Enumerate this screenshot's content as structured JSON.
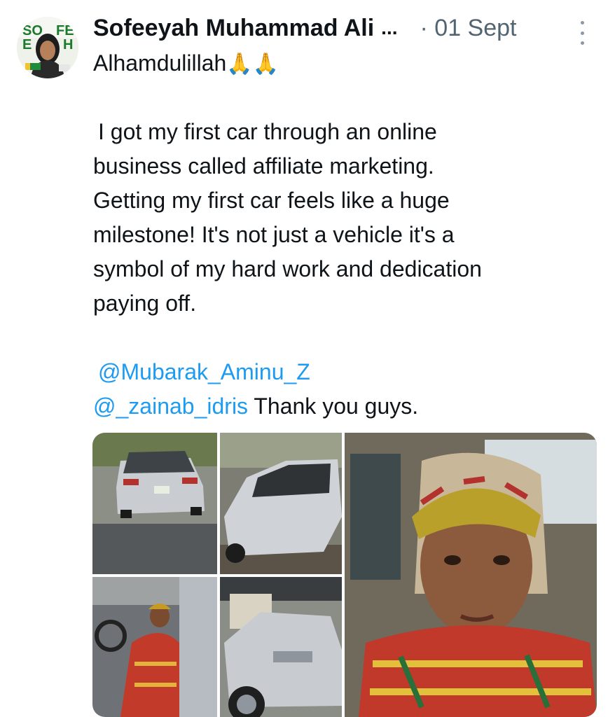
{
  "tweet": {
    "author": {
      "display_name": "Sofeeyah Muhammad Ali",
      "truncation": "...",
      "avatar_label": "profile-photo"
    },
    "separator": "·",
    "date": "01 Sept",
    "text_lines": [
      "Alhamdulillah",
      "",
      "I got my first car through an online",
      "business called affiliate marketing.",
      "Getting my first car feels like a huge",
      "milestone! It's not just a vehicle it's a",
      "symbol of my hard work and dedication",
      "paying off.",
      ""
    ],
    "emoji": "🙏🙏",
    "mentions": [
      "@Mubarak_Aminu_Z",
      "@_zainab_idris"
    ],
    "closing_text": " Thank you guys.",
    "avatar_text": {
      "top": "SOFE",
      "bottom": "EYAH"
    },
    "photos": [
      "car-rear-view",
      "car-side-view",
      "woman-in-driver-seat",
      "car-front-view",
      "selfie-in-car"
    ]
  },
  "colors": {
    "text": "#0f1419",
    "secondary": "#536471",
    "link": "#1d9bf0"
  }
}
